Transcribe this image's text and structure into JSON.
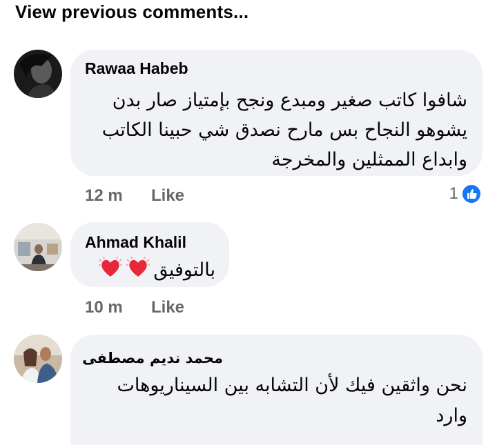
{
  "view_previous": "View previous comments...",
  "comments": [
    {
      "author": "Rawaa Habeb",
      "lines": [
        "شافوا كاتب صغير ومبدع ونجح بإمتياز صار بدن",
        "يشوهو النجاح   بس مارح نصدق شي حبينا الكاتب",
        "وابداع الممثلين والمخرجة"
      ],
      "time": "12 m",
      "like_label": "Like",
      "reaction_count": "1",
      "reaction_icon": "like-reaction-icon"
    },
    {
      "author": "Ahmad Khalil",
      "text": "بالتوفيق",
      "emoji": "sparkling-heart-icon",
      "time": "10 m",
      "like_label": "Like"
    },
    {
      "author": "محمد نديم مصطفى",
      "lines": [
        "نحن واثقين فيك لأن التشابه بين السيناريوهات",
        "وارد"
      ]
    }
  ],
  "colors": {
    "bubble": "#f0f2f5",
    "meta_text": "#65676b",
    "like_blue": "#1877f2"
  }
}
